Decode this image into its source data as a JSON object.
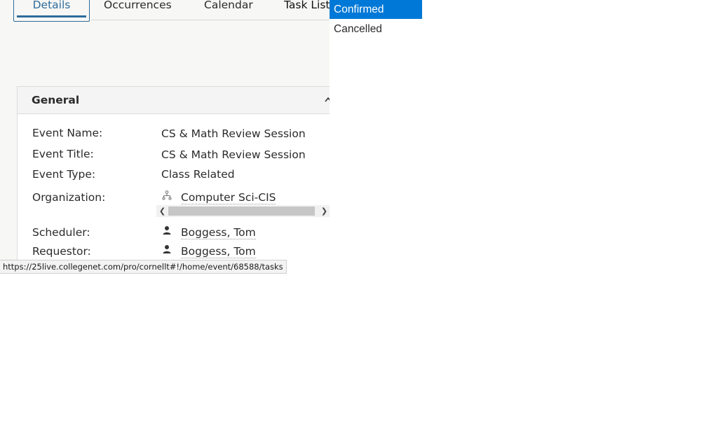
{
  "tabs": [
    {
      "label": "Details"
    },
    {
      "label": "Occurrences"
    },
    {
      "label": "Calendar"
    },
    {
      "label": "Task List"
    }
  ],
  "general": {
    "title": "General",
    "fields": {
      "event_name": {
        "label": "Event Name:",
        "value": "CS & Math Review Session"
      },
      "event_title": {
        "label": "Event Title:",
        "value": "CS & Math Review Session"
      },
      "event_type": {
        "label": "Event Type:",
        "value": "Class Related"
      },
      "organization": {
        "label": "Organization:",
        "value": "Computer Sci-CIS",
        "icon": "org-chart-icon"
      },
      "scheduler": {
        "label": "Scheduler:",
        "value": "Boggess, Tom",
        "icon": "person-icon"
      },
      "requestor": {
        "label": "Requestor:",
        "value": "Boggess, Tom",
        "icon": "person-icon"
      }
    }
  },
  "status_bar": {
    "url": "https://25live.collegenet.com/pro/cornellt#!/home/event/68588/tasks"
  },
  "dropdown": {
    "options": [
      {
        "label": "Confirmed",
        "selected": true
      },
      {
        "label": "Cancelled",
        "selected": false
      }
    ]
  },
  "colors": {
    "accent": "#2d6c9b",
    "selection": "#0078d7"
  }
}
